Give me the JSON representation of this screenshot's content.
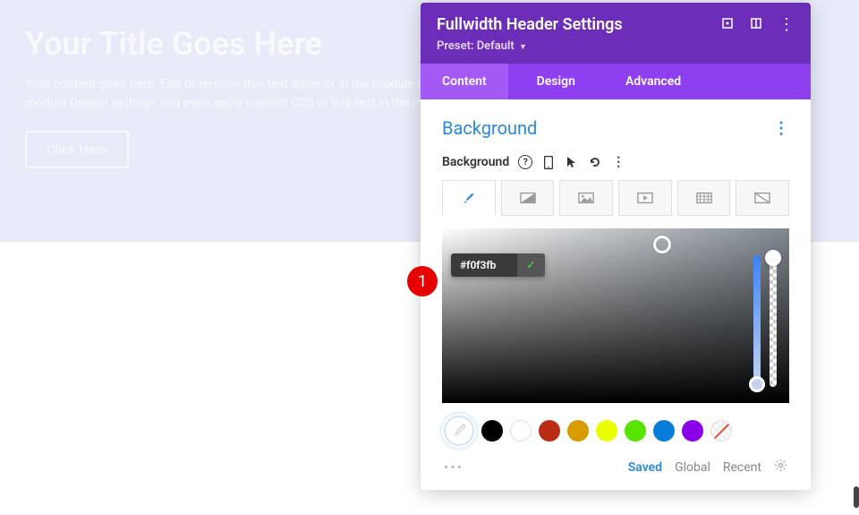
{
  "page": {
    "title": "Your Title Goes Here",
    "description": "Your content goes here. Edit or remove this text inline or in the module Content settings. You can also style every aspect of this content in the module Design settings and even apply custom CSS to this text in the module Advanced settings.",
    "button": "Click Here"
  },
  "panel": {
    "title": "Fullwidth Header Settings",
    "preset_label": "Preset:",
    "preset_value": "Default"
  },
  "tabs": {
    "content": "Content",
    "design": "Design",
    "advanced": "Advanced"
  },
  "section": {
    "title": "Background",
    "label": "Background"
  },
  "color": {
    "hex": "#f0f3fb",
    "swatches": [
      "#000000",
      "#ffffff",
      "#b92d17",
      "#d89b00",
      "#eaff00",
      "#57e400",
      "#0a7ddb",
      "#8a00e6"
    ]
  },
  "footer": {
    "saved": "Saved",
    "global": "Global",
    "recent": "Recent"
  },
  "callout": "1"
}
